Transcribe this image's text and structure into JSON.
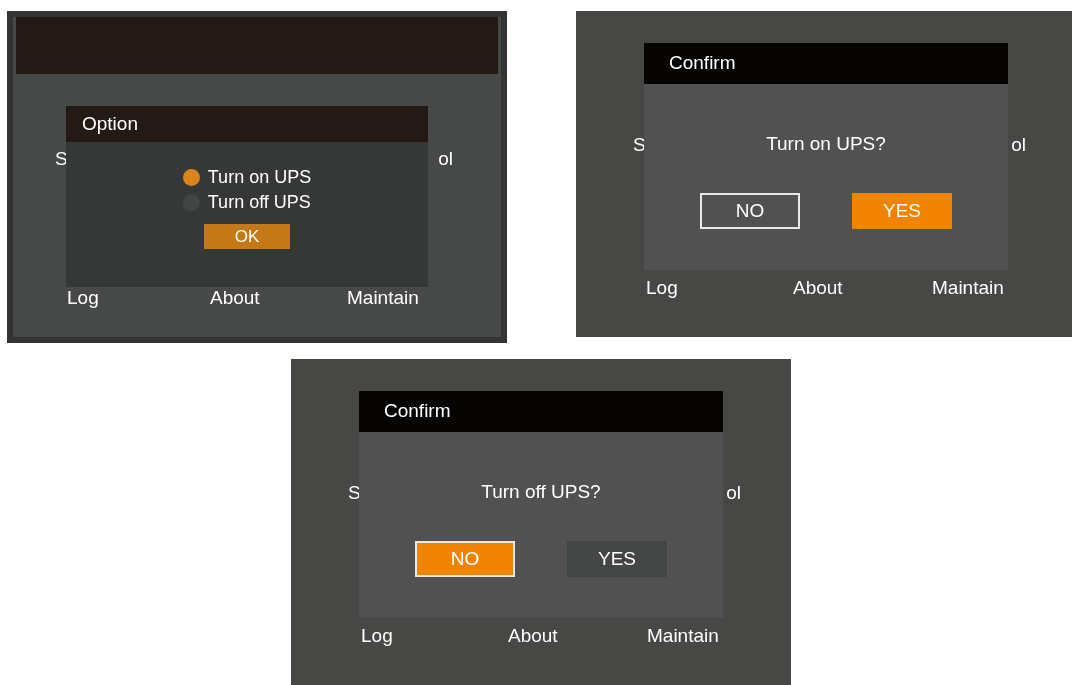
{
  "screens": [
    {
      "kind": "option",
      "menu": {
        "row_1": [
          "S",
          "ol"
        ],
        "row_2": [
          "Log",
          "About",
          "Maintain"
        ]
      },
      "dialog": {
        "title": "Option",
        "options": [
          {
            "label": "Turn on UPS",
            "selected": true
          },
          {
            "label": "Turn off UPS",
            "selected": false
          }
        ],
        "buttons": [
          {
            "label": "OK",
            "selected": true,
            "outlined": false
          }
        ]
      }
    },
    {
      "kind": "confirm",
      "menu": {
        "row_1": [
          "S",
          "ol"
        ],
        "row_2": [
          "Log",
          "About",
          "Maintain"
        ]
      },
      "dialog": {
        "title": "Confirm",
        "message": "Turn on UPS?",
        "buttons": [
          {
            "label": "NO",
            "selected": false,
            "outlined": true
          },
          {
            "label": "YES",
            "selected": true,
            "outlined": false
          }
        ]
      }
    },
    {
      "kind": "confirm",
      "menu": {
        "row_1": [
          "S",
          "ol"
        ],
        "row_2": [
          "Log",
          "About",
          "Maintain"
        ]
      },
      "dialog": {
        "title": "Confirm",
        "message": "Turn off UPS?",
        "buttons": [
          {
            "label": "NO",
            "selected": true,
            "outlined": true
          },
          {
            "label": "YES",
            "selected": false,
            "outlined": false
          }
        ]
      }
    }
  ]
}
